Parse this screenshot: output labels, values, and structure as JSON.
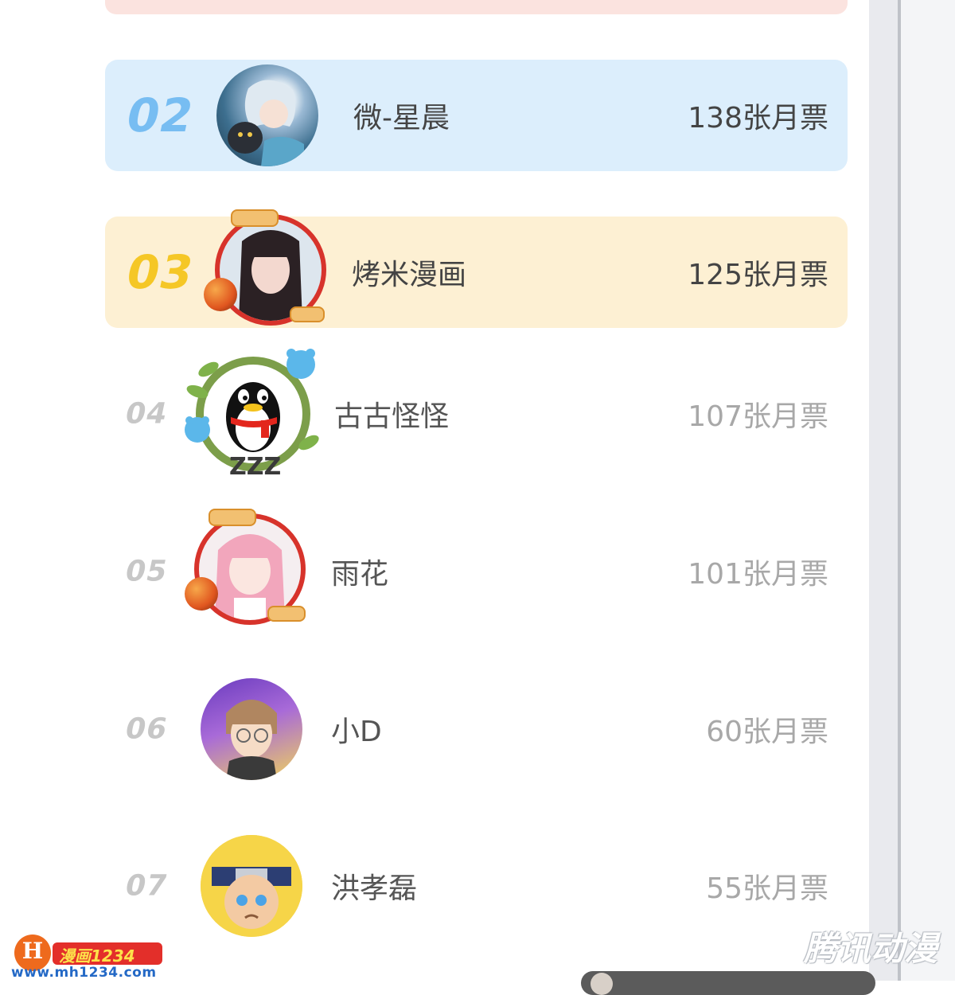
{
  "colors": {
    "rank2_bg": "#dceefc",
    "rank3_bg": "#fdf0d3",
    "rank1_bg": "#fbe3df",
    "rank2_number": "#77bdf2",
    "rank3_number": "#f5c726",
    "other_number": "#c7c7c7"
  },
  "leaderboard": [
    {
      "rank": "02",
      "name": "微-星晨",
      "votes": "138张月票",
      "avatar": "anime-boy-avatar"
    },
    {
      "rank": "03",
      "name": "烤米漫画",
      "votes": "125张月票",
      "avatar": "girl-photo-avatar"
    },
    {
      "rank": "04",
      "name": "古古怪怪",
      "votes": "107张月票",
      "avatar": "qq-penguin-avatar"
    },
    {
      "rank": "05",
      "name": "雨花",
      "votes": "101张月票",
      "avatar": "pink-hair-girl-avatar"
    },
    {
      "rank": "06",
      "name": "小D",
      "votes": "60张月票",
      "avatar": "glasses-boy-avatar"
    },
    {
      "rank": "07",
      "name": "洪孝磊",
      "votes": "55张月票",
      "avatar": "naruto-avatar"
    }
  ],
  "watermarks": {
    "left_logo": "H",
    "left_badge": "漫画1234",
    "left_url": "www.mh1234.com",
    "right_text": "腾讯动漫"
  }
}
